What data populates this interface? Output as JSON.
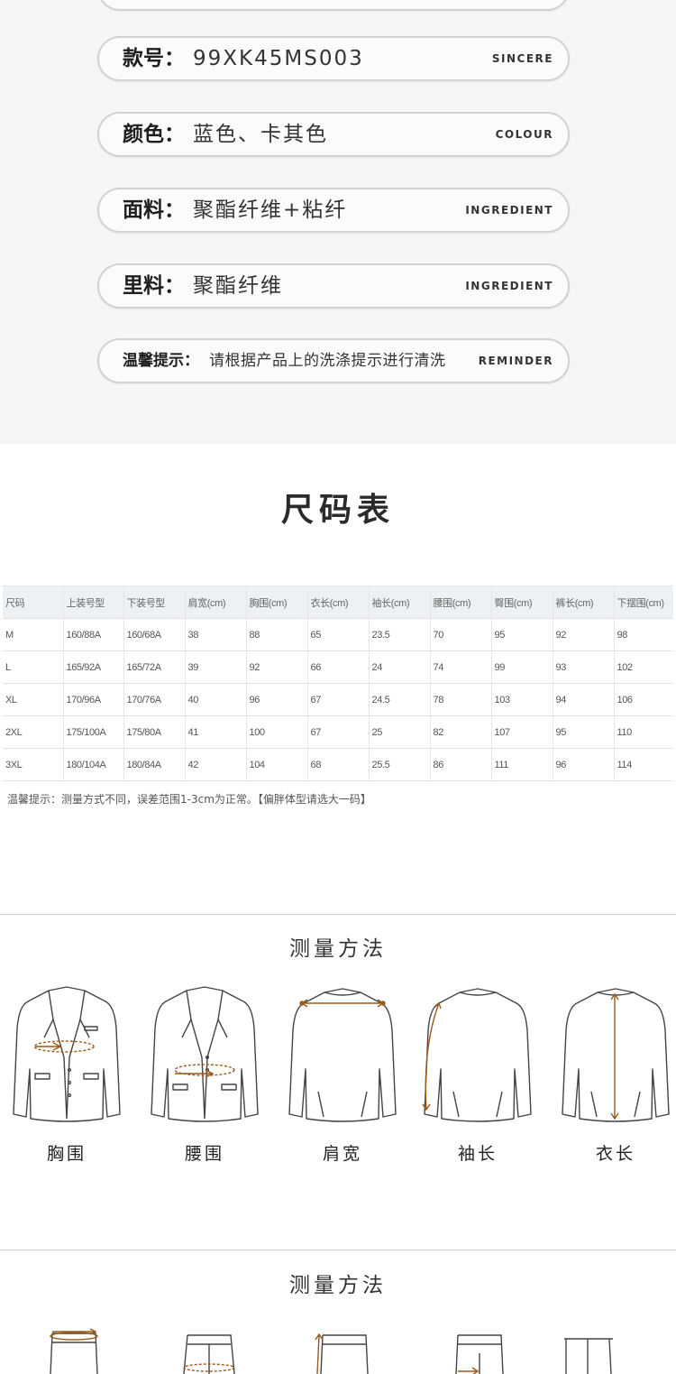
{
  "info": [
    {
      "label": "款号：",
      "value": "99XK45MS003",
      "en": "SINCERE"
    },
    {
      "label": "颜色：",
      "value": "蓝色、卡其色",
      "en": "COLOUR"
    },
    {
      "label": "面料：",
      "value": "聚酯纤维+粘纤",
      "en": "INGREDIENT"
    },
    {
      "label": "里料：",
      "value": "聚酯纤维",
      "en": "INGREDIENT"
    },
    {
      "label": "温馨提示：",
      "value": "请根据产品上的洗涤提示进行清洗",
      "en": "REMINDER"
    }
  ],
  "size_chart": {
    "title": "尺码表",
    "headers": [
      "尺码",
      "上装号型",
      "下装号型",
      "肩宽(cm)",
      "胸围(cm)",
      "衣长(cm)",
      "袖长(cm)",
      "腰围(cm)",
      "臀围(cm)",
      "裤长(cm)",
      "下摆围(cm)"
    ],
    "rows": [
      [
        "M",
        "160/88A",
        "160/68A",
        "38",
        "88",
        "65",
        "23.5",
        "70",
        "95",
        "92",
        "98"
      ],
      [
        "L",
        "165/92A",
        "165/72A",
        "39",
        "92",
        "66",
        "24",
        "74",
        "99",
        "93",
        "102"
      ],
      [
        "XL",
        "170/96A",
        "170/76A",
        "40",
        "96",
        "67",
        "24.5",
        "78",
        "103",
        "94",
        "106"
      ],
      [
        "2XL",
        "175/100A",
        "175/80A",
        "41",
        "100",
        "67",
        "25",
        "82",
        "107",
        "95",
        "110"
      ],
      [
        "3XL",
        "180/104A",
        "180/84A",
        "42",
        "104",
        "68",
        "25.5",
        "86",
        "111",
        "96",
        "114"
      ]
    ],
    "note": "温馨提示：测量方式不同，误差范围1-3cm为正常。【偏胖体型请选大一码】"
  },
  "measure_jacket": {
    "title": "测量方法",
    "items": [
      {
        "label": "胸围",
        "icon": "jacket-chest-icon"
      },
      {
        "label": "腰围",
        "icon": "jacket-waist-icon"
      },
      {
        "label": "肩宽",
        "icon": "jacket-shoulder-icon"
      },
      {
        "label": "袖长",
        "icon": "jacket-sleeve-icon"
      },
      {
        "label": "衣长",
        "icon": "jacket-length-icon"
      }
    ]
  },
  "measure_pants": {
    "title": "测量方法",
    "items": [
      {
        "icon": "pants-waist-icon"
      },
      {
        "icon": "pants-hip-icon"
      },
      {
        "icon": "pants-rise-icon"
      },
      {
        "icon": "pants-thigh-icon"
      },
      {
        "icon": "pants-length-icon"
      }
    ]
  },
  "colors": {
    "measure_line": "#9a5a1c",
    "outline": "#444444",
    "pill_border": "#d2d2d2"
  }
}
